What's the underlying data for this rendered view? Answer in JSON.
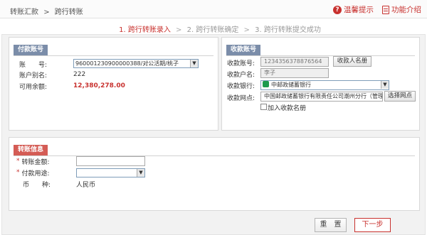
{
  "breadcrumb": {
    "parent": "转账汇款",
    "separator": ">",
    "current": "跨行转账"
  },
  "toplinks": {
    "help": "温馨提示",
    "intro": "功能介绍"
  },
  "steps": [
    {
      "label": "1. 跨行转账录入"
    },
    {
      "label": "2. 跨行转账确定"
    },
    {
      "label": "3. 跨行转账提交成功"
    }
  ],
  "step_sep": ">",
  "payer": {
    "title": "付款账号",
    "account_label": "账　　号:",
    "account_value": "960001230900000388/对公活期/桃子",
    "alias_label": "账户别名:",
    "alias_value": "222",
    "balance_label": "可用余额:",
    "balance_value": "12,380,278.00"
  },
  "payee": {
    "title": "收款账号",
    "account_label": "收款账号:",
    "account_value": "1234356378876564",
    "name_btn": "收款人名册",
    "name_label": "收款户名:",
    "name_value": "李子",
    "bank_label": "收款银行:",
    "bank_value": "中邮政储蓄银行",
    "branch_label": "收款网点:",
    "branch_value": "中国邮政储蓄银行有限责任公司潮州分行（管理",
    "branch_btn": "选择网点",
    "add_label": "加入收款名册"
  },
  "transfer": {
    "title": "转账信息",
    "amount_label": "转账金额:",
    "purpose_label": "付款用途:",
    "currency_label": "币　　种:",
    "currency_value": "人民币"
  },
  "buttons": {
    "reset": "重　置",
    "next": "下一步"
  }
}
